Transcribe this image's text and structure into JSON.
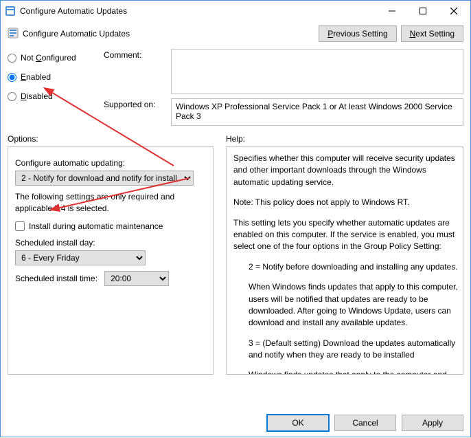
{
  "window": {
    "title": "Configure Automatic Updates"
  },
  "subheader": {
    "title": "Configure Automatic Updates",
    "prev": "Previous Setting",
    "next": "Next Setting"
  },
  "radios": {
    "not_configured": "Not Configured",
    "enabled": "Enabled",
    "disabled": "Disabled",
    "selected": "enabled"
  },
  "fields": {
    "comment_label": "Comment:",
    "comment_value": "",
    "supported_label": "Supported on:",
    "supported_value": "Windows XP Professional Service Pack 1 or At least Windows 2000 Service Pack 3"
  },
  "sections": {
    "options": "Options:",
    "help": "Help:"
  },
  "options_panel": {
    "configure_label": "Configure automatic updating:",
    "configure_value": "2 - Notify for download and notify for install",
    "hint": "The following settings are only required and applicable if 4 is selected.",
    "install_maint": "Install during automatic maintenance",
    "day_label": "Scheduled install day:",
    "day_value": "6 - Every Friday",
    "time_label": "Scheduled install time:",
    "time_value": "20:00"
  },
  "help_text": {
    "p1": "Specifies whether this computer will receive security updates and other important downloads through the Windows automatic updating service.",
    "p2": "Note: This policy does not apply to Windows RT.",
    "p3": "This setting lets you specify whether automatic updates are enabled on this computer. If the service is enabled, you must select one of the four options in the Group Policy Setting:",
    "p4": "2 = Notify before downloading and installing any updates.",
    "p5": "When Windows finds updates that apply to this computer, users will be notified that updates are ready to be downloaded. After going to Windows Update, users can download and install any available updates.",
    "p6": "3 = (Default setting) Download the updates automatically and notify when they are ready to be installed",
    "p7": "Windows finds updates that apply to the computer and"
  },
  "buttons": {
    "ok": "OK",
    "cancel": "Cancel",
    "apply": "Apply"
  }
}
